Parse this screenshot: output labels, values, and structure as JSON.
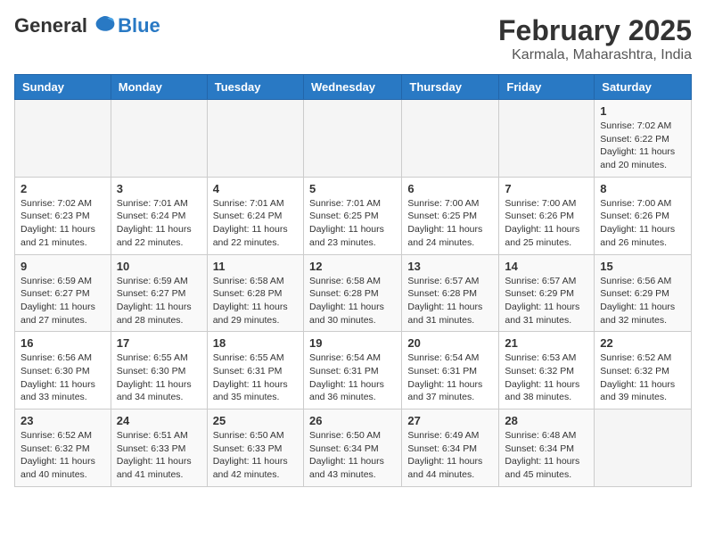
{
  "logo": {
    "line1": "General",
    "line2": "Blue"
  },
  "title": "February 2025",
  "location": "Karmala, Maharashtra, India",
  "weekdays": [
    "Sunday",
    "Monday",
    "Tuesday",
    "Wednesday",
    "Thursday",
    "Friday",
    "Saturday"
  ],
  "weeks": [
    [
      {
        "day": "",
        "info": ""
      },
      {
        "day": "",
        "info": ""
      },
      {
        "day": "",
        "info": ""
      },
      {
        "day": "",
        "info": ""
      },
      {
        "day": "",
        "info": ""
      },
      {
        "day": "",
        "info": ""
      },
      {
        "day": "1",
        "info": "Sunrise: 7:02 AM\nSunset: 6:22 PM\nDaylight: 11 hours and 20 minutes."
      }
    ],
    [
      {
        "day": "2",
        "info": "Sunrise: 7:02 AM\nSunset: 6:23 PM\nDaylight: 11 hours and 21 minutes."
      },
      {
        "day": "3",
        "info": "Sunrise: 7:01 AM\nSunset: 6:24 PM\nDaylight: 11 hours and 22 minutes."
      },
      {
        "day": "4",
        "info": "Sunrise: 7:01 AM\nSunset: 6:24 PM\nDaylight: 11 hours and 22 minutes."
      },
      {
        "day": "5",
        "info": "Sunrise: 7:01 AM\nSunset: 6:25 PM\nDaylight: 11 hours and 23 minutes."
      },
      {
        "day": "6",
        "info": "Sunrise: 7:00 AM\nSunset: 6:25 PM\nDaylight: 11 hours and 24 minutes."
      },
      {
        "day": "7",
        "info": "Sunrise: 7:00 AM\nSunset: 6:26 PM\nDaylight: 11 hours and 25 minutes."
      },
      {
        "day": "8",
        "info": "Sunrise: 7:00 AM\nSunset: 6:26 PM\nDaylight: 11 hours and 26 minutes."
      }
    ],
    [
      {
        "day": "9",
        "info": "Sunrise: 6:59 AM\nSunset: 6:27 PM\nDaylight: 11 hours and 27 minutes."
      },
      {
        "day": "10",
        "info": "Sunrise: 6:59 AM\nSunset: 6:27 PM\nDaylight: 11 hours and 28 minutes."
      },
      {
        "day": "11",
        "info": "Sunrise: 6:58 AM\nSunset: 6:28 PM\nDaylight: 11 hours and 29 minutes."
      },
      {
        "day": "12",
        "info": "Sunrise: 6:58 AM\nSunset: 6:28 PM\nDaylight: 11 hours and 30 minutes."
      },
      {
        "day": "13",
        "info": "Sunrise: 6:57 AM\nSunset: 6:28 PM\nDaylight: 11 hours and 31 minutes."
      },
      {
        "day": "14",
        "info": "Sunrise: 6:57 AM\nSunset: 6:29 PM\nDaylight: 11 hours and 31 minutes."
      },
      {
        "day": "15",
        "info": "Sunrise: 6:56 AM\nSunset: 6:29 PM\nDaylight: 11 hours and 32 minutes."
      }
    ],
    [
      {
        "day": "16",
        "info": "Sunrise: 6:56 AM\nSunset: 6:30 PM\nDaylight: 11 hours and 33 minutes."
      },
      {
        "day": "17",
        "info": "Sunrise: 6:55 AM\nSunset: 6:30 PM\nDaylight: 11 hours and 34 minutes."
      },
      {
        "day": "18",
        "info": "Sunrise: 6:55 AM\nSunset: 6:31 PM\nDaylight: 11 hours and 35 minutes."
      },
      {
        "day": "19",
        "info": "Sunrise: 6:54 AM\nSunset: 6:31 PM\nDaylight: 11 hours and 36 minutes."
      },
      {
        "day": "20",
        "info": "Sunrise: 6:54 AM\nSunset: 6:31 PM\nDaylight: 11 hours and 37 minutes."
      },
      {
        "day": "21",
        "info": "Sunrise: 6:53 AM\nSunset: 6:32 PM\nDaylight: 11 hours and 38 minutes."
      },
      {
        "day": "22",
        "info": "Sunrise: 6:52 AM\nSunset: 6:32 PM\nDaylight: 11 hours and 39 minutes."
      }
    ],
    [
      {
        "day": "23",
        "info": "Sunrise: 6:52 AM\nSunset: 6:32 PM\nDaylight: 11 hours and 40 minutes."
      },
      {
        "day": "24",
        "info": "Sunrise: 6:51 AM\nSunset: 6:33 PM\nDaylight: 11 hours and 41 minutes."
      },
      {
        "day": "25",
        "info": "Sunrise: 6:50 AM\nSunset: 6:33 PM\nDaylight: 11 hours and 42 minutes."
      },
      {
        "day": "26",
        "info": "Sunrise: 6:50 AM\nSunset: 6:34 PM\nDaylight: 11 hours and 43 minutes."
      },
      {
        "day": "27",
        "info": "Sunrise: 6:49 AM\nSunset: 6:34 PM\nDaylight: 11 hours and 44 minutes."
      },
      {
        "day": "28",
        "info": "Sunrise: 6:48 AM\nSunset: 6:34 PM\nDaylight: 11 hours and 45 minutes."
      },
      {
        "day": "",
        "info": ""
      }
    ]
  ]
}
